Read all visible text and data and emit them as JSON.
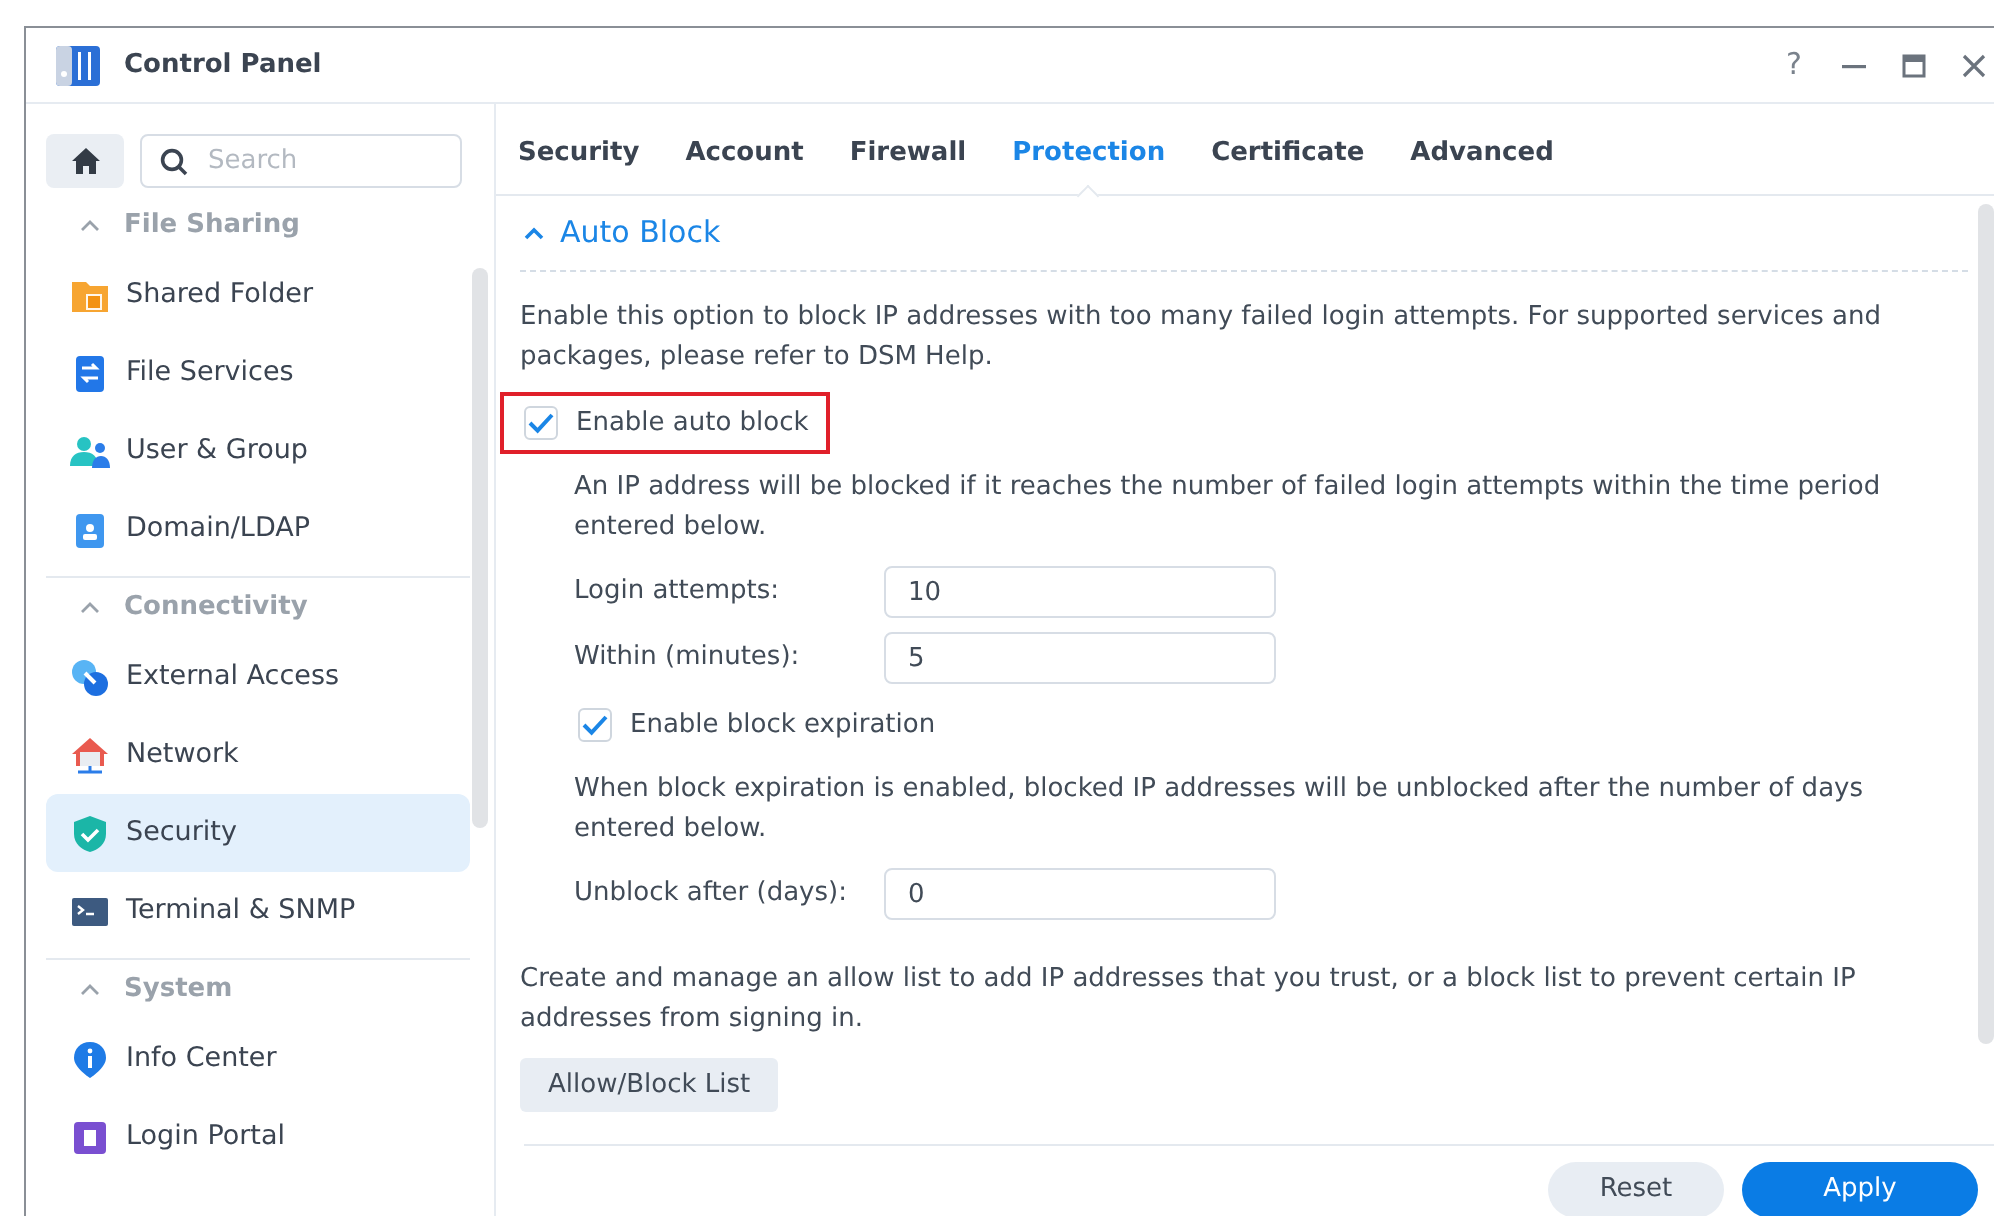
{
  "window": {
    "title": "Control Panel",
    "help": "?"
  },
  "sidebar": {
    "search": {
      "placeholder": "Search"
    },
    "sections": [
      {
        "title": "File Sharing",
        "expanded": true,
        "items": [
          {
            "label": "Shared Folder",
            "selected": false
          },
          {
            "label": "File Services",
            "selected": false
          },
          {
            "label": "User & Group",
            "selected": false
          },
          {
            "label": "Domain/LDAP",
            "selected": false
          }
        ]
      },
      {
        "title": "Connectivity",
        "expanded": true,
        "items": [
          {
            "label": "External Access",
            "selected": false
          },
          {
            "label": "Network",
            "selected": false
          },
          {
            "label": "Security",
            "selected": true
          },
          {
            "label": "Terminal & SNMP",
            "selected": false
          }
        ]
      },
      {
        "title": "System",
        "expanded": true,
        "items": [
          {
            "label": "Info Center",
            "selected": false
          },
          {
            "label": "Login Portal",
            "selected": false
          }
        ]
      }
    ]
  },
  "tabs": [
    {
      "label": "Security",
      "selected": false
    },
    {
      "label": "Account",
      "selected": false
    },
    {
      "label": "Firewall",
      "selected": false
    },
    {
      "label": "Protection",
      "selected": true
    },
    {
      "label": "Certificate",
      "selected": false
    },
    {
      "label": "Advanced",
      "selected": false
    }
  ],
  "section": {
    "title": "Auto Block",
    "expanded": true,
    "content": [
      {
        "kind": "text",
        "text": "Enable this option to block IP addresses with too many failed login attempts. For supported services and packages, please refer to DSM Help."
      },
      {
        "kind": "checkbox",
        "label": "Enable auto block",
        "checked": true,
        "highlighted": true,
        "children": [
          {
            "kind": "text",
            "text": "An IP address will be blocked if it reaches the number of failed login attempts within the time period entered below."
          },
          {
            "kind": "field",
            "label": "Login attempts:",
            "value": "10"
          },
          {
            "kind": "field",
            "label": "Within (minutes):",
            "value": "5"
          },
          {
            "kind": "checkbox",
            "label": "Enable block expiration",
            "checked": true,
            "highlighted": false
          },
          {
            "kind": "text",
            "text": "When block expiration is enabled, blocked IP addresses will be unblocked after the number of days entered below."
          },
          {
            "kind": "field",
            "label": "Unblock after (days):",
            "value": "0"
          }
        ]
      },
      {
        "kind": "text",
        "text": "Create and manage an allow list to add IP addresses that you trust, or a block list to prevent certain IP addresses from signing in."
      },
      {
        "kind": "button",
        "label": "Allow/Block List"
      }
    ]
  },
  "footer": {
    "buttons": [
      {
        "label": "Reset",
        "primary": false
      },
      {
        "label": "Apply",
        "primary": true
      }
    ]
  }
}
